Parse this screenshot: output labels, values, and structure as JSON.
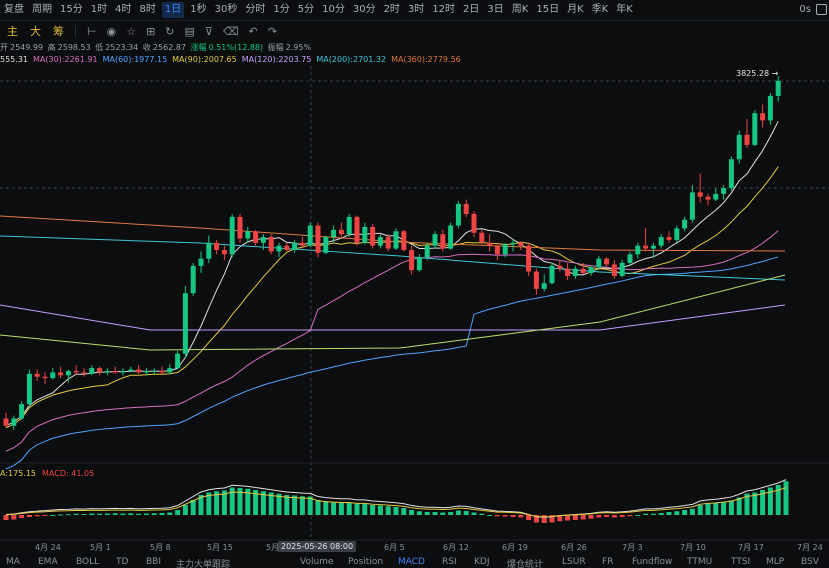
{
  "topbar": {
    "items": [
      "复盘",
      "周期",
      "15分",
      "1时",
      "4时",
      "8时",
      "1日",
      "1秒",
      "30秒",
      "分时",
      "1分",
      "5分",
      "10分",
      "30分",
      "2时",
      "3时",
      "12时",
      "2日",
      "3日",
      "周K",
      "15日",
      "月K",
      "季K",
      "年K"
    ],
    "active_index": 6,
    "right_label": "0s"
  },
  "toolbar": {
    "tabs": [
      "主",
      "大",
      "筹"
    ],
    "tools": [
      "ruler-icon",
      "camera-icon",
      "star-icon",
      "grid-icon",
      "refresh-icon",
      "chart-icon",
      "filter-icon",
      "trash-icon",
      "undo-icon",
      "redo-icon"
    ]
  },
  "ohlc": {
    "open_label": "开",
    "open": "2549.99",
    "high_label": "高",
    "high": "2598.53",
    "low_label": "低",
    "low": "2523.34",
    "close_label": "收",
    "close": "2562.87",
    "change_label": "涨幅",
    "change": "0.51%(12.88)",
    "amplitude_label": "振幅",
    "amplitude": "2.95%"
  },
  "ma_lines": [
    {
      "text": "555.31",
      "color": "#e0e0e0"
    },
    {
      "text": "MA(30):2261.91",
      "color": "#d66fc0"
    },
    {
      "text": "MA(60):1977.15",
      "color": "#4da3ff"
    },
    {
      "text": "MA(90):2007.65",
      "color": "#e2c940"
    },
    {
      "text": "MA(120):2203.75",
      "color": "#c3a0ff"
    },
    {
      "text": "MA(200):2701.32",
      "color": "#3ec7d6"
    },
    {
      "text": "MA(360):2779.56",
      "color": "#e07a3c"
    }
  ],
  "last_price_tag": "3825.28",
  "macd_labels": [
    {
      "text": "A:175.15",
      "color": "#e2c940"
    },
    {
      "text": "MACD: 41.05",
      "color": "#ef4444"
    }
  ],
  "x_axis": [
    "4月 24",
    "5月 1",
    "5月 8",
    "5月 15",
    "5月",
    "6月 5",
    "6月 12",
    "6月 19",
    "6月 26",
    "7月 3",
    "7月 10",
    "7月 17",
    "7月 24"
  ],
  "crosshair_time": "2025-05-26 08:00",
  "bottom_tabs": [
    "MA",
    "EMA",
    "BOLL",
    "TD",
    "BBI",
    "主力大单跟踪",
    "Volume",
    "Position",
    "MACD",
    "RSI",
    "KDJ",
    "爆仓统计",
    "LSUR",
    "FR",
    "Fundflow",
    "TTMU",
    "TTSI",
    "MLP",
    "BSV"
  ],
  "bottom_tab_active": "MACD",
  "colors": {
    "up": "#16c784",
    "down": "#ef4444",
    "crosshair": "#6b7078"
  },
  "chart_data": {
    "type": "candlestick",
    "x_start": "2025-04-20",
    "interval": "1d",
    "y_range": [
      1400,
      3900
    ],
    "ohlc": [
      [
        1480,
        1520,
        1420,
        1430
      ],
      [
        1430,
        1500,
        1400,
        1480
      ],
      [
        1480,
        1600,
        1470,
        1580
      ],
      [
        1580,
        1820,
        1560,
        1790
      ],
      [
        1790,
        1820,
        1740,
        1770
      ],
      [
        1770,
        1800,
        1720,
        1760
      ],
      [
        1760,
        1830,
        1750,
        1800
      ],
      [
        1800,
        1840,
        1760,
        1780
      ],
      [
        1780,
        1820,
        1730,
        1810
      ],
      [
        1810,
        1850,
        1780,
        1800
      ],
      [
        1800,
        1830,
        1770,
        1790
      ],
      [
        1790,
        1850,
        1780,
        1830
      ],
      [
        1830,
        1840,
        1780,
        1800
      ],
      [
        1800,
        1830,
        1780,
        1810
      ],
      [
        1810,
        1840,
        1790,
        1800
      ],
      [
        1800,
        1830,
        1780,
        1810
      ],
      [
        1810,
        1840,
        1800,
        1820
      ],
      [
        1820,
        1850,
        1790,
        1800
      ],
      [
        1800,
        1830,
        1780,
        1810
      ],
      [
        1810,
        1830,
        1790,
        1810
      ],
      [
        1810,
        1840,
        1790,
        1800
      ],
      [
        1800,
        1860,
        1790,
        1830
      ],
      [
        1830,
        1950,
        1820,
        1930
      ],
      [
        1930,
        2400,
        1900,
        2350
      ],
      [
        2350,
        2560,
        2330,
        2540
      ],
      [
        2540,
        2640,
        2490,
        2590
      ],
      [
        2590,
        2750,
        2560,
        2700
      ],
      [
        2700,
        2720,
        2620,
        2650
      ],
      [
        2650,
        2680,
        2580,
        2620
      ],
      [
        2620,
        2900,
        2600,
        2880
      ],
      [
        2880,
        2900,
        2700,
        2730
      ],
      [
        2730,
        2810,
        2700,
        2780
      ],
      [
        2780,
        2790,
        2680,
        2700
      ],
      [
        2700,
        2760,
        2650,
        2740
      ],
      [
        2740,
        2760,
        2620,
        2640
      ],
      [
        2640,
        2700,
        2600,
        2680
      ],
      [
        2680,
        2700,
        2640,
        2650
      ],
      [
        2650,
        2720,
        2630,
        2700
      ],
      [
        2700,
        2740,
        2660,
        2680
      ],
      [
        2680,
        2840,
        2670,
        2820
      ],
      [
        2820,
        2840,
        2600,
        2630
      ],
      [
        2630,
        2750,
        2620,
        2740
      ],
      [
        2740,
        2820,
        2700,
        2790
      ],
      [
        2790,
        2840,
        2740,
        2760
      ],
      [
        2760,
        2900,
        2740,
        2880
      ],
      [
        2880,
        2890,
        2680,
        2700
      ],
      [
        2700,
        2840,
        2690,
        2810
      ],
      [
        2810,
        2830,
        2660,
        2680
      ],
      [
        2680,
        2760,
        2660,
        2740
      ],
      [
        2740,
        2760,
        2640,
        2660
      ],
      [
        2660,
        2800,
        2650,
        2780
      ],
      [
        2780,
        2790,
        2640,
        2650
      ],
      [
        2650,
        2680,
        2480,
        2510
      ],
      [
        2510,
        2620,
        2500,
        2600
      ],
      [
        2600,
        2700,
        2580,
        2680
      ],
      [
        2680,
        2780,
        2660,
        2760
      ],
      [
        2760,
        2790,
        2640,
        2660
      ],
      [
        2660,
        2840,
        2650,
        2820
      ],
      [
        2820,
        2990,
        2800,
        2970
      ],
      [
        2970,
        3000,
        2880,
        2900
      ],
      [
        2900,
        2920,
        2740,
        2770
      ],
      [
        2770,
        2790,
        2690,
        2700
      ],
      [
        2700,
        2760,
        2640,
        2680
      ],
      [
        2680,
        2700,
        2580,
        2620
      ],
      [
        2620,
        2700,
        2600,
        2690
      ],
      [
        2690,
        2720,
        2640,
        2700
      ],
      [
        2700,
        2710,
        2650,
        2680
      ],
      [
        2680,
        2700,
        2470,
        2500
      ],
      [
        2500,
        2520,
        2340,
        2380
      ],
      [
        2380,
        2480,
        2360,
        2420
      ],
      [
        2420,
        2560,
        2410,
        2540
      ],
      [
        2540,
        2580,
        2500,
        2520
      ],
      [
        2520,
        2560,
        2440,
        2470
      ],
      [
        2470,
        2540,
        2450,
        2520
      ],
      [
        2520,
        2560,
        2480,
        2490
      ],
      [
        2490,
        2540,
        2470,
        2530
      ],
      [
        2530,
        2610,
        2510,
        2590
      ],
      [
        2590,
        2600,
        2530,
        2550
      ],
      [
        2550,
        2580,
        2450,
        2470
      ],
      [
        2470,
        2580,
        2460,
        2560
      ],
      [
        2560,
        2640,
        2540,
        2620
      ],
      [
        2620,
        2700,
        2590,
        2680
      ],
      [
        2680,
        2800,
        2640,
        2660
      ],
      [
        2660,
        2700,
        2600,
        2680
      ],
      [
        2680,
        2760,
        2660,
        2740
      ],
      [
        2740,
        2780,
        2700,
        2720
      ],
      [
        2720,
        2820,
        2700,
        2800
      ],
      [
        2800,
        2880,
        2780,
        2860
      ],
      [
        2860,
        3100,
        2840,
        3050
      ],
      [
        3050,
        3180,
        2980,
        3020
      ],
      [
        3020,
        3040,
        2960,
        3000
      ],
      [
        3000,
        3080,
        2990,
        3040
      ],
      [
        3040,
        3100,
        3000,
        3080
      ],
      [
        3080,
        3300,
        3060,
        3280
      ],
      [
        3280,
        3480,
        3250,
        3450
      ],
      [
        3450,
        3560,
        3360,
        3380
      ],
      [
        3380,
        3620,
        3370,
        3600
      ],
      [
        3600,
        3660,
        3500,
        3550
      ],
      [
        3550,
        3740,
        3520,
        3720
      ],
      [
        3720,
        3860,
        3680,
        3825
      ]
    ],
    "macd_hist": [
      -20,
      -18,
      -12,
      -8,
      -5,
      -3,
      0,
      2,
      3,
      5,
      4,
      6,
      5,
      6,
      7,
      6,
      7,
      5,
      6,
      7,
      8,
      10,
      20,
      40,
      60,
      80,
      90,
      95,
      98,
      110,
      108,
      105,
      100,
      95,
      90,
      85,
      80,
      78,
      75,
      74,
      60,
      55,
      52,
      50,
      50,
      45,
      45,
      40,
      38,
      35,
      32,
      28,
      20,
      15,
      12,
      12,
      10,
      12,
      18,
      16,
      10,
      5,
      0,
      -5,
      -6,
      -8,
      -10,
      -20,
      -30,
      -32,
      -30,
      -25,
      -22,
      -20,
      -18,
      -15,
      -10,
      -8,
      -10,
      -8,
      -5,
      0,
      5,
      5,
      8,
      12,
      15,
      20,
      25,
      40,
      45,
      48,
      52,
      58,
      70,
      85,
      90,
      100,
      110,
      120,
      135
    ],
    "macd_ylim": [
      -60,
      160
    ]
  }
}
